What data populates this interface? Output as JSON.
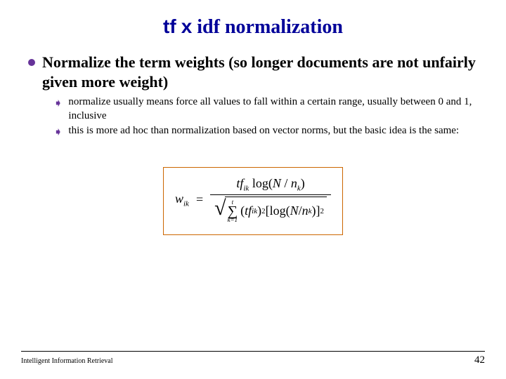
{
  "title": {
    "tf": "tf",
    "x": "x",
    "rest": " idf normalization"
  },
  "main_bullet": "Normalize the term weights (so longer documents are not unfairly given more weight)",
  "sub_bullets": [
    "normalize usually means force all values to fall within a certain range, usually between 0 and 1, inclusive",
    "this is more ad hoc than normalization based on vector norms, but the basic idea is the same:"
  ],
  "formula": {
    "lhs_base": "w",
    "lhs_sub": "ik",
    "num_tf": "tf",
    "num_tf_sub": "ik",
    "num_log": " log(",
    "num_N": "N",
    "num_slash": " / ",
    "num_n": "n",
    "num_n_sub": "k",
    "num_close": ")",
    "den_sum_top": "t",
    "den_sum_bot": "k=1",
    "den_tf": "tf",
    "den_tf_sub": "ik",
    "den_sq1": "2",
    "den_log": "log(",
    "den_N": "N",
    "den_slash": " / ",
    "den_n": "n",
    "den_n_sub": "k",
    "den_close": ")",
    "den_sq2": "2"
  },
  "footer": {
    "left": "Intelligent Information Retrieval",
    "page": "42"
  }
}
